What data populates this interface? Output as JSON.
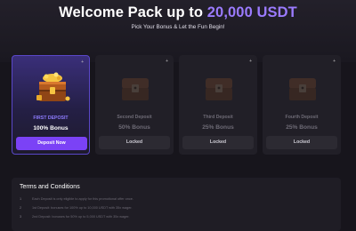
{
  "header": {
    "title_prefix": "Welcome Pack up to ",
    "title_highlight": "20,000 USDT",
    "subtitle": "Pick Your Bonus & Let the Fun Begin!"
  },
  "cards": [
    {
      "label": "FIRST DEPOSIT",
      "value": "100% Bonus",
      "button": "Deposit Now",
      "state": "active",
      "corner": "+"
    },
    {
      "label": "Second Deposit",
      "value": "50% Bonus",
      "button": "Locked",
      "state": "locked",
      "corner": "+"
    },
    {
      "label": "Third Deposit",
      "value": "25% Bonus",
      "button": "Locked",
      "state": "locked",
      "corner": "+"
    },
    {
      "label": "Fourth Deposit",
      "value": "25% Bonus",
      "button": "Locked",
      "state": "locked",
      "corner": "+"
    }
  ],
  "terms": {
    "title": "Terms and Conditions",
    "items": [
      {
        "num": "1",
        "text": "Each Deposit is only eligible to apply for this promotional offer once."
      },
      {
        "num": "2",
        "text": "1st Deposit: bonuses for 100% up to 10,000 USDT with 35x wager."
      },
      {
        "num": "3",
        "text": "2nd Deposit: bonuses for 50% up to 5,000 USDT with 35x wager."
      }
    ]
  },
  "colors": {
    "accent": "#7b42f6",
    "highlight": "#9b7bff",
    "background": "#17151c"
  }
}
